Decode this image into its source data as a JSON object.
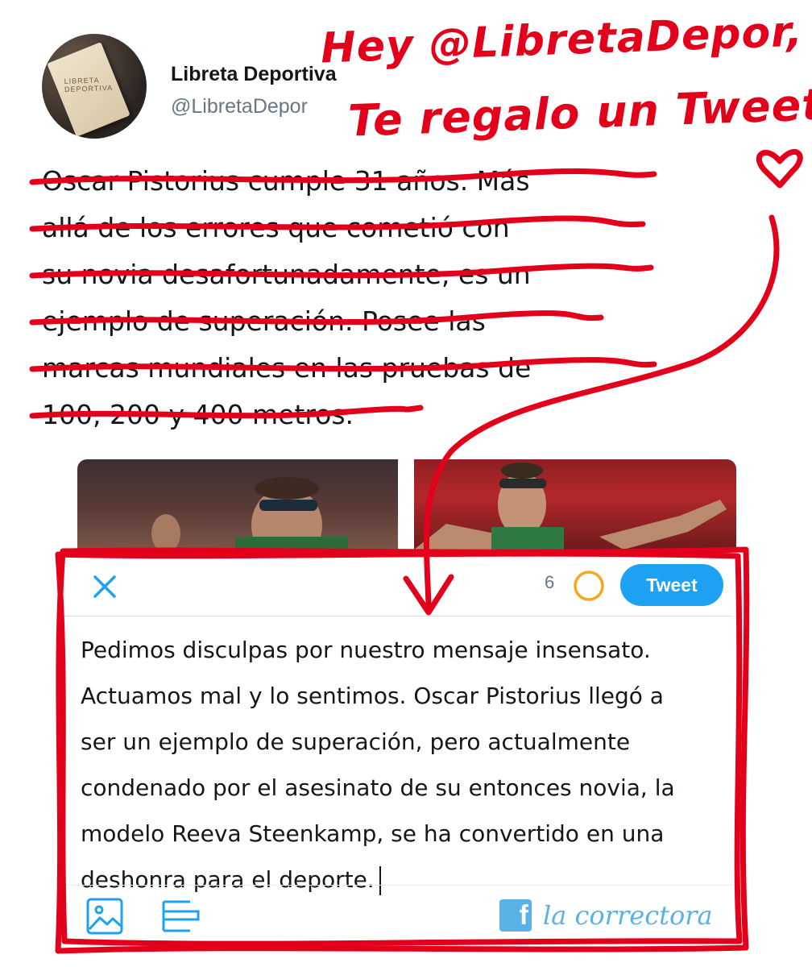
{
  "profile": {
    "display_name": "Libreta Deportiva",
    "handle": "@LibretaDepor",
    "avatar_label": "LIBRETA DEPORTIVA"
  },
  "tweet": {
    "text_lines": [
      "Oscar Pistorius cumple 31 años. Más",
      "allá de los errores que cometió con",
      "su novia desafortunadamente, es un",
      "ejemplo de superación. Posee las",
      "marcas mundiales en las pruebas de",
      "100, 200 y 400 metros."
    ],
    "strikethrough": true
  },
  "compose": {
    "char_count": "6",
    "tweet_button_label": "Tweet",
    "text_lines": [
      "Pedimos disculpas por nuestro mensaje insensato.",
      "Actuamos mal y lo sentimos. Oscar Pistorius llegó a",
      "ser un ejemplo de superación, pero actualmente",
      "condenado por el asesinato de su entonces novia, la",
      "modelo Reeva Steenkamp, se ha convertido en una",
      "deshonra para el deporte."
    ],
    "close_icon": "close-icon",
    "progress_icon": "progress-ring-icon",
    "image_icon": "image-icon",
    "thread_icon": "thread-icon"
  },
  "annotation": {
    "line1": "Hey @LibretaDepor,",
    "line2": "Te regalo un Tweet.",
    "heart_icon": "heart-icon",
    "color": "#e3001b"
  },
  "brand": {
    "icon": "facebook-icon",
    "label": "la correctora",
    "color": "#5ab1e6"
  },
  "colors": {
    "accent": "#1da1f2",
    "annotation": "#e3001b",
    "progress": "#f5a623"
  }
}
